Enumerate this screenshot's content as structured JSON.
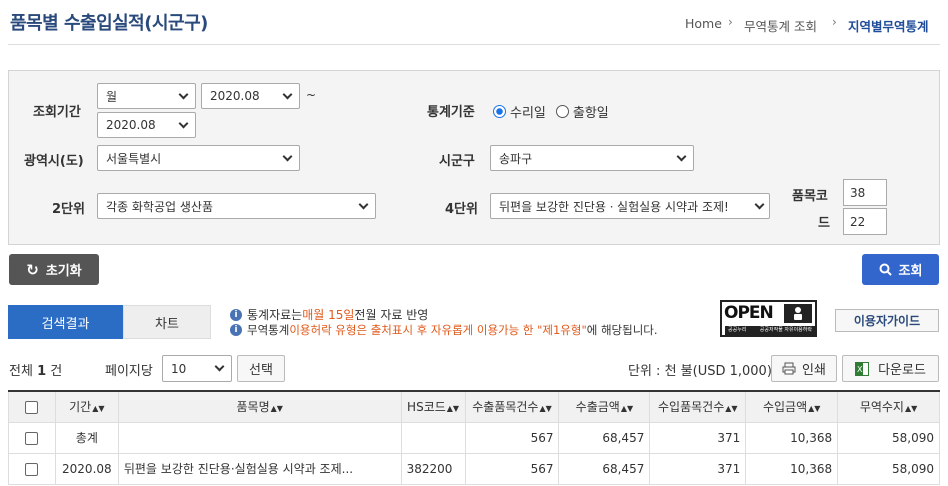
{
  "header": {
    "title": "품목별 수출입실적(시군구)",
    "breadcrumb": [
      "Home",
      "무역통계 조회",
      "지역별무역통계"
    ]
  },
  "form": {
    "period_label": "조회기간",
    "period_unit": "월",
    "period_from": "2020.08",
    "tilde": "~",
    "period_to": "2020.08",
    "basis_label": "통계기준",
    "basis_options": [
      "수리일",
      "출항일"
    ],
    "province_label": "광역시(도)",
    "province_value": "서울특별시",
    "city_label": "시군구",
    "city_value": "송파구",
    "unit2_label": "2단위",
    "unit2_value": "각종 화학공업 생산품",
    "unit4_label": "4단위",
    "unit4_value": "뒤편을 보강한 진단용ㆍ실험실용 시약과 조제!",
    "code_label_1": "품목코",
    "code_label_2": "드",
    "code_value_1": "38",
    "code_value_2": "22"
  },
  "buttons": {
    "reset": "초기화",
    "search": "조회",
    "guide": "이용자가이드",
    "select": "선택",
    "print": "인쇄",
    "download": "다운로드"
  },
  "tabs": [
    "검색결과",
    "차트"
  ],
  "notice": {
    "line1": [
      "통계자료는 ",
      "매월 15일",
      " 전월 자료 반영"
    ],
    "line2": [
      "무역통계 ",
      "이용허락 유형은 출처표시 후 자유롭게 이용가능 한 \"제1유형\"",
      "에 해당됩니다."
    ],
    "open_badge": "OPEN",
    "badge_sub1": "공공누리",
    "badge_sub2": "공공저작물 자유이용허락"
  },
  "summary": {
    "total_label": "전체",
    "total_count": "1",
    "total_unit": "건",
    "per_page_label": "페이지당",
    "per_page": "10",
    "unit_text": "단위 : 천 불(USD 1,000)"
  },
  "table": {
    "headers": [
      "기간",
      "품목명",
      "HS코드",
      "수출품목건수",
      "수출금액",
      "수입품목건수",
      "수입금액",
      "무역수지"
    ],
    "total_row": [
      "총계",
      "",
      "",
      "567",
      "68,457",
      "371",
      "10,368",
      "58,090"
    ],
    "rows": [
      [
        "2020.08",
        "뒤편을 보강한 진단용·실험실용 시약과 조제...",
        "382200",
        "567",
        "68,457",
        "371",
        "10,368",
        "58,090"
      ]
    ]
  }
}
